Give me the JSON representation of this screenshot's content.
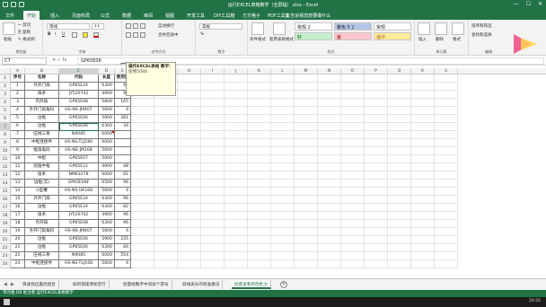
{
  "window": {
    "title": "运行EXCEL表格教学（全屏幅）.xlsx - Excel",
    "min": "—",
    "max": "☐",
    "close": "✕"
  },
  "tabs": [
    "文件",
    "开始",
    "插入",
    "页面布局",
    "公式",
    "数据",
    "审阅",
    "视图",
    "开发工具",
    "DIY工具箱",
    "方方格子",
    "PDF工具集"
  ],
  "active_tab": "开始",
  "tell_me": "♀ 告诉我您想要做什么",
  "ribbon": {
    "clipboard": {
      "label": "剪贴板",
      "paste": "粘贴",
      "cut": "✂ 剪切",
      "copy": "⎘ 复制",
      "format_painter": "✎ 格式刷"
    },
    "font": {
      "label": "字体",
      "name": "等线",
      "size": "11",
      "bold": "B",
      "italic": "I",
      "underline": "U"
    },
    "alignment": {
      "label": "对齐方式",
      "wrap": "自动换行",
      "merge": "合并后居中"
    },
    "number": {
      "label": "数字",
      "format": "常规",
      "percent": "%"
    },
    "styles": {
      "label": "样式",
      "cond_format": "条件格式",
      "table_format": "套用表格格式",
      "s1": "常规 2",
      "s2": "着色 5 2",
      "s3": "常规",
      "s4": "好",
      "s5": "差",
      "s6": "适中"
    },
    "cells": {
      "label": "单元格",
      "insert": "插入",
      "delete": "删除",
      "format": "格式"
    },
    "editing": {
      "label": "编辑",
      "sort": "排序和筛选",
      "find": "查找和选择"
    }
  },
  "formula_bar": {
    "namebox": "C7",
    "fx": "✕ ✓ fx",
    "value": "GP65E06"
  },
  "columns": [
    "A",
    "B",
    "C",
    "D",
    "E",
    "F",
    "G",
    "H",
    "I",
    "J",
    "K",
    "L",
    "M",
    "N",
    "O",
    "P",
    "Q",
    "R",
    "S"
  ],
  "headers": [
    "序号",
    "名称",
    "代码",
    "长度",
    "使用量"
  ],
  "rows": [
    [
      "1",
      "外开门扇",
      "GP65E24",
      "6300",
      "96"
    ],
    [
      "2",
      "扇条",
      "JY520742",
      "4900",
      "96"
    ],
    [
      "3",
      "内开扇",
      "GP65E08",
      "5800",
      "165"
    ],
    [
      "4",
      "外开门扇角码",
      "HS-NS-JM407",
      "5600",
      "4"
    ],
    [
      "5",
      "边框",
      "GP65E06",
      "5900",
      "281"
    ],
    [
      "6",
      "边框",
      "GP65E06",
      "6300",
      "34"
    ],
    [
      "7",
      "压线三骨",
      "N9085",
      "6000",
      ""
    ],
    [
      "8",
      "中框连接件",
      "HS-NS-TLJ180",
      "6000",
      ""
    ],
    [
      "9",
      "框扇角码",
      "HS-NS-JM168",
      "5600",
      ""
    ],
    [
      "10",
      "中梃",
      "GP65E07",
      "5900",
      ""
    ],
    [
      "11",
      "加强中框",
      "GP65E12",
      "4900",
      "48"
    ],
    [
      "12",
      "扇条",
      "NM63278",
      "6000",
      "81"
    ],
    [
      "13",
      "边框(实)",
      "GP65E06F",
      "6500",
      "96"
    ],
    [
      "14",
      "U型槽",
      "HS-NS-UK168",
      "5600",
      "4"
    ],
    [
      "15",
      "外开门扇",
      "GP65E24",
      "6300",
      "96"
    ],
    [
      "16",
      "边框",
      "GP65E24",
      "6300",
      "82"
    ],
    [
      "17",
      "扇条",
      "JY520742",
      "4900",
      "96"
    ],
    [
      "18",
      "内开扇",
      "GP65E08",
      "6300",
      "96"
    ],
    [
      "19",
      "外开门扇角码",
      "HS-NS-JM407",
      "5600",
      "4"
    ],
    [
      "20",
      "边框",
      "GP65E06",
      "5900",
      "235"
    ],
    [
      "21",
      "边框",
      "GP65E06",
      "6300",
      "84"
    ],
    [
      "22",
      "压线三骨",
      "N9085",
      "6000",
      "554"
    ],
    [
      "23",
      "中框连接件",
      "HS-NS-TLJ168",
      "5600",
      "4"
    ],
    [
      "24",
      "框扇角码",
      "HS-NS-JM168",
      "5600",
      "4"
    ],
    [
      "25",
      "中梃",
      "GP65E07",
      "5900",
      "4"
    ]
  ],
  "comment": {
    "line1": "操作EXCEL表格 教学：",
    "line2": "使用5088"
  },
  "sheets": [
    "快速找出最优组合",
    "如何快速添加空行",
    "批量给数字中间加个冒号",
    "斜线表头的标准做法",
    "批量查看修改批注"
  ],
  "active_sheet": "批量查看修改批注",
  "status": "单元格 D8 批注者 运行EXCEL表格教学",
  "clock": "20:20"
}
